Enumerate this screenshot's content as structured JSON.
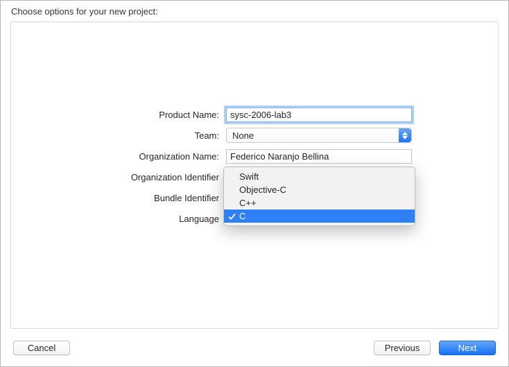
{
  "header": {
    "title": "Choose options for your new project:"
  },
  "form": {
    "product_name": {
      "label": "Product Name:",
      "value": "sysc-2006-lab3"
    },
    "team": {
      "label": "Team:",
      "value": "None"
    },
    "org_name": {
      "label": "Organization Name:",
      "value": "Federico Naranjo Bellina"
    },
    "org_identifier": {
      "label": "Organization Identifier"
    },
    "bundle_identifier": {
      "label": "Bundle Identifier"
    },
    "language": {
      "label": "Language"
    }
  },
  "dropdown": {
    "items": [
      {
        "label": "Swift",
        "selected": false
      },
      {
        "label": "Objective-C",
        "selected": false
      },
      {
        "label": "C++",
        "selected": false
      },
      {
        "label": "C",
        "selected": true
      }
    ]
  },
  "footer": {
    "cancel": "Cancel",
    "previous": "Previous",
    "next": "Next"
  }
}
